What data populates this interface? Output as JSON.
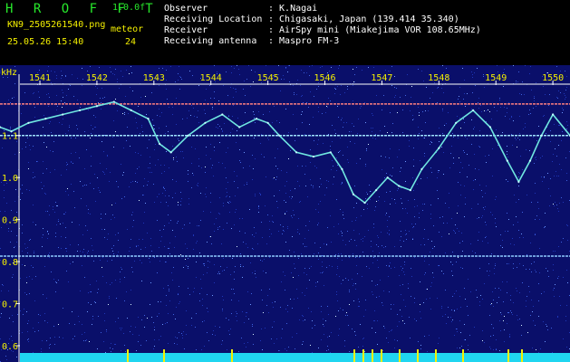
{
  "header": {
    "app_name": "H R O F F T",
    "version": "1.0.0f",
    "filename": "KN9_2505261540.png",
    "datetime": "25.05.26 15:40",
    "mode_label": "meteor",
    "mode_value": "24",
    "info": [
      {
        "key": "Observer",
        "value": ": K.Nagai"
      },
      {
        "key": "Receiving Location",
        "value": ": Chigasaki, Japan (139.414 35.340)"
      },
      {
        "key": "Receiver",
        "value": ": AirSpy mini (Miakejima VOR 108.65MHz)"
      },
      {
        "key": "Receiving antenna",
        "value": ": Maspro FM-3"
      }
    ]
  },
  "chart_data": {
    "type": "heatmap",
    "ylabel": "kHz",
    "ylim": [
      0.6,
      1.22
    ],
    "yticks": [
      "1.1",
      "1.0",
      "0.9",
      "0.8",
      "0.7",
      "0.6"
    ],
    "ytick_values": [
      1.1,
      1.0,
      0.9,
      0.8,
      0.7,
      0.6
    ],
    "xlim": [
      1540.3,
      1550.3
    ],
    "xticks": [
      "1541",
      "1542",
      "1543",
      "1544",
      "1545",
      "1546",
      "1547",
      "1548",
      "1549",
      "1550"
    ],
    "xtick_values": [
      1541,
      1542,
      1543,
      1544,
      1545,
      1546,
      1547,
      1548,
      1549,
      1550
    ],
    "series": [
      {
        "type": "line",
        "x": [
          1540.3,
          1540.5,
          1540.8,
          1541.1,
          1541.4,
          1541.7,
          1542.0,
          1542.3,
          1542.6,
          1542.9,
          1543.1,
          1543.3,
          1543.6,
          1543.9,
          1544.2,
          1544.5,
          1544.8,
          1545.0,
          1545.2,
          1545.5,
          1545.8,
          1546.1,
          1546.3,
          1546.5,
          1546.7,
          1546.9,
          1547.1,
          1547.3,
          1547.5,
          1547.7,
          1548.0,
          1548.3,
          1548.6,
          1548.9,
          1549.2,
          1549.4,
          1549.6,
          1549.8,
          1550.0,
          1550.3
        ],
        "y": [
          1.12,
          1.11,
          1.13,
          1.14,
          1.15,
          1.16,
          1.17,
          1.18,
          1.16,
          1.14,
          1.08,
          1.06,
          1.1,
          1.13,
          1.15,
          1.12,
          1.14,
          1.13,
          1.1,
          1.06,
          1.05,
          1.06,
          1.02,
          0.96,
          0.94,
          0.97,
          1.0,
          0.98,
          0.97,
          1.02,
          1.07,
          1.13,
          1.16,
          1.12,
          1.04,
          0.99,
          1.04,
          1.1,
          1.15,
          1.1
        ]
      }
    ],
    "hlines": [
      {
        "y": 1.1,
        "color": "#9fe3ff"
      },
      {
        "y": 0.813,
        "color": "#8ecbff"
      },
      {
        "y": 1.175,
        "color": "#ff7f7f"
      }
    ],
    "colors": {
      "background": "#0a0f6a",
      "trace": "#6fe6e0",
      "axis": "#ffffff",
      "tick_label": "#f4f000"
    }
  }
}
